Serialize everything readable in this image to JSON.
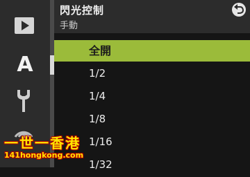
{
  "header": {
    "title": "閃光控制",
    "subtitle": "手動"
  },
  "sidebar": {
    "items": [
      {
        "icon": "play-icon"
      },
      {
        "icon": "auto-mode-icon",
        "label": "A"
      },
      {
        "icon": "wrench-icon"
      },
      {
        "icon": "wireless-icon"
      }
    ]
  },
  "list": {
    "items": [
      {
        "label": "全開",
        "selected": true
      },
      {
        "label": "1/2"
      },
      {
        "label": "1/4"
      },
      {
        "label": "1/8"
      },
      {
        "label": "1/16"
      },
      {
        "label": "1/32"
      }
    ]
  },
  "watermark": {
    "main": "一世一香港",
    "url": "141hongkong.com"
  },
  "colors": {
    "accent": "#9bbb3a",
    "background": "#151515",
    "panel": "#2c2c2c"
  }
}
